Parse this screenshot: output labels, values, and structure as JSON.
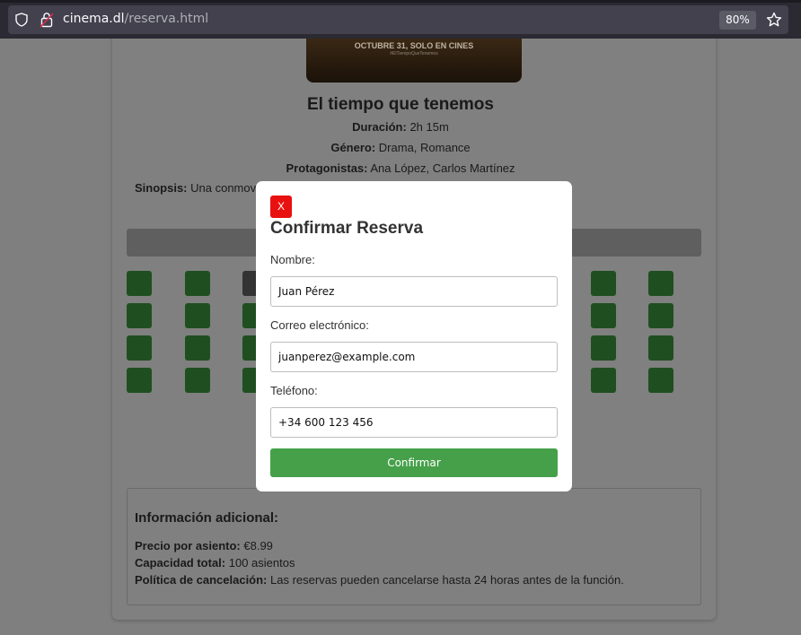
{
  "browser": {
    "url_host": "cinema.dl",
    "url_path": "/reserva.html",
    "zoom": "80%",
    "icons": [
      "shield-icon",
      "lock-icon",
      "star-icon"
    ]
  },
  "poster": {
    "headline": "OCTUBRE 31, SOLO EN CINES",
    "hashtag": "#ElTiempoQueTenemos"
  },
  "movie": {
    "title": "El tiempo que tenemos",
    "duration_label": "Duración:",
    "duration": "2h 15m",
    "genre_label": "Género:",
    "genre": "Drama, Romance",
    "cast_label": "Protagonistas:",
    "cast": "Ana López, Carlos Martínez",
    "synopsis_label": "Sinopsis:",
    "synopsis": "Una conmovedora historia de amor cuyo significado en los momentos"
  },
  "seats": {
    "rows": 4,
    "columns": 10,
    "occupied": [
      [
        0,
        2
      ]
    ],
    "colors": {
      "available": "#3a9a3e",
      "occupied": "#666666"
    }
  },
  "info": {
    "heading": "Información adicional:",
    "price_label": "Precio por asiento:",
    "price": "€8.99",
    "capacity_label": "Capacidad total:",
    "capacity": "100 asientos",
    "policy_label": "Política de cancelación:",
    "policy": "Las reservas pueden cancelarse hasta 24 horas antes de la función."
  },
  "modal": {
    "close_label": "X",
    "title": "Confirmar Reserva",
    "name_label": "Nombre:",
    "name_value": "Juan Pérez",
    "email_label": "Correo electrónico:",
    "email_value": "juanperez@example.com",
    "phone_label": "Teléfono:",
    "phone_value": "+34 600 123 456",
    "confirm_label": "Confirmar",
    "colors": {
      "close": "#e8110f",
      "confirm": "#45a049"
    }
  }
}
